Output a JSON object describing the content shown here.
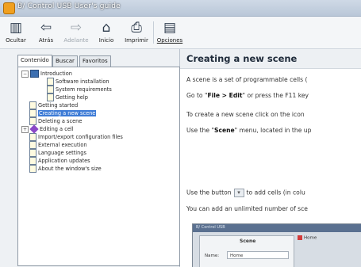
{
  "window": {
    "title": "B/ Control USB User's guide"
  },
  "toolbar": {
    "buttons": [
      {
        "label": "Ocultar",
        "icon": "hide-pane-icon"
      },
      {
        "label": "Atrás",
        "icon": "back-arrow-icon"
      },
      {
        "label": "Adelante",
        "icon": "forward-arrow-icon",
        "disabled": true
      },
      {
        "label": "Inicio",
        "icon": "home-icon"
      },
      {
        "label": "Imprimir",
        "icon": "printer-icon"
      },
      {
        "label": "Opciones",
        "icon": "options-icon"
      }
    ]
  },
  "tabs": [
    "Contenido",
    "Buscar",
    "Favoritos"
  ],
  "tree": [
    {
      "text": "Introduction",
      "level": 0,
      "type": "book",
      "expander": "−"
    },
    {
      "text": "Software installation",
      "level": 2,
      "type": "page"
    },
    {
      "text": "System requirements",
      "level": 2,
      "type": "page"
    },
    {
      "text": "Getting help",
      "level": 2,
      "type": "page"
    },
    {
      "text": "Getting started",
      "level": 1,
      "type": "page"
    },
    {
      "text": "Creating a new scene",
      "level": 1,
      "type": "page",
      "selected": true
    },
    {
      "text": "Deleting a scene",
      "level": 1,
      "type": "page"
    },
    {
      "text": "Editing a cell",
      "level": 0,
      "type": "diamond",
      "expander": "+"
    },
    {
      "text": "Import/export configuration files",
      "level": 1,
      "type": "page"
    },
    {
      "text": "External execution",
      "level": 1,
      "type": "page"
    },
    {
      "text": "Language settings",
      "level": 1,
      "type": "page"
    },
    {
      "text": "Application updates",
      "level": 1,
      "type": "page"
    },
    {
      "text": "About the window's size",
      "level": 1,
      "type": "page"
    }
  ],
  "content": {
    "heading": "Creating a new scene",
    "p1": "A scene is a set of programmable cells (",
    "p2_pre": "Go to \"",
    "p2_bold": "File > Edit",
    "p2_post": "\" or press the F11 key",
    "p3": "To create a new scene click on the icon",
    "p4_pre": "Use the \"",
    "p4_bold": "Scene",
    "p4_post": "\" menu, located in the up",
    "p5_pre": "Use the button",
    "p5_post": "to add cells (in colu",
    "p6": "You can add an unlimited number of sce"
  },
  "screenshot": {
    "title": "B/ Control USB",
    "panel_title": "Scene",
    "name_label": "Name:",
    "name_value": "Home",
    "tab1": "Home"
  },
  "colors": {
    "selection": "#3d7bd6",
    "heading": "#1f2b3a"
  }
}
